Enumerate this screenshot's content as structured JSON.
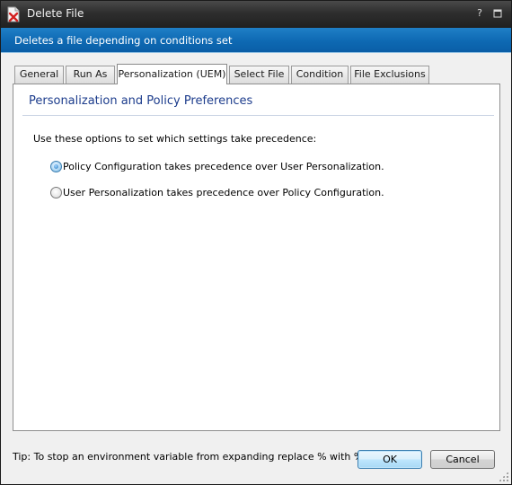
{
  "window": {
    "title": "Delete File",
    "help_glyph": "?",
    "maximize_glyph": "▫"
  },
  "banner": {
    "description": "Deletes a file depending on conditions set"
  },
  "tabs": [
    {
      "label": "General",
      "active": false
    },
    {
      "label": "Run As",
      "active": false
    },
    {
      "label": "Personalization (UEM)",
      "active": true
    },
    {
      "label": "Select File",
      "active": false
    },
    {
      "label": "Condition",
      "active": false
    },
    {
      "label": "File Exclusions",
      "active": false
    }
  ],
  "panel": {
    "section_title": "Personalization and Policy Preferences",
    "instruction": "Use these options to set which settings take precedence:",
    "options": [
      {
        "label": "Policy Configuration takes precedence over User Personalization.",
        "checked": true
      },
      {
        "label": "User Personalization takes precedence over Policy Configuration.",
        "checked": false
      }
    ]
  },
  "footer": {
    "tip": "Tip: To stop an environment variable from expanding replace % with %%.",
    "ok_label": "OK",
    "cancel_label": "Cancel"
  },
  "colors": {
    "title_bar": "#2e2e2e",
    "banner": "#0e69b3",
    "section_title": "#1c3c8c"
  }
}
